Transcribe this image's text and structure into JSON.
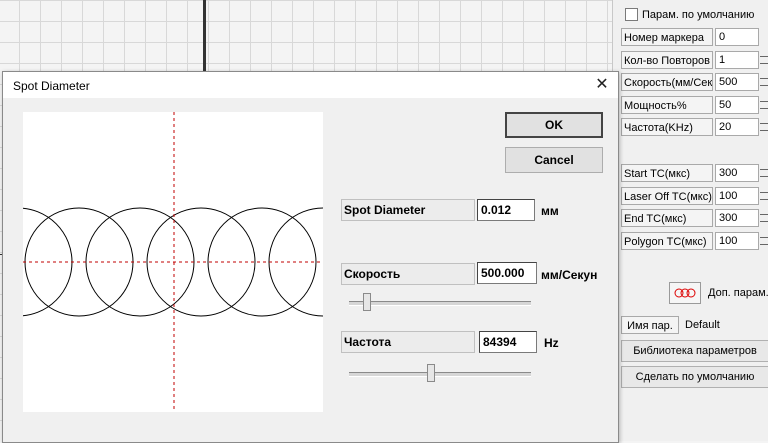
{
  "right_panel": {
    "default_checkbox": {
      "label": "Парам. по умолчанию",
      "checked": false
    },
    "params_top": [
      {
        "label": "Номер маркера",
        "value": "0",
        "spinner": false
      },
      {
        "label": "Кол-во Повторов",
        "value": "1",
        "spinner": true
      },
      {
        "label": "Скорость(мм/Сек",
        "value": "500",
        "spinner": true
      },
      {
        "label": "Мощность%",
        "value": "50",
        "spinner": true
      },
      {
        "label": "Частота(KHz)",
        "value": "20",
        "spinner": true
      }
    ],
    "params_timing": [
      {
        "label": "Start TC(мкс)",
        "value": "300",
        "spinner": true
      },
      {
        "label": "Laser Off TC(мкс)",
        "value": "100",
        "spinner": true
      },
      {
        "label": "End TC(мкс)",
        "value": "300",
        "spinner": true
      },
      {
        "label": "Polygon TC(мкс)",
        "value": "100",
        "spinner": true
      }
    ],
    "extra_params_label": "Доп. парам.",
    "name_label": "Имя пар.",
    "name_value": "Default",
    "library_button": "Библиотека параметров",
    "make_default_button": "Сделать по умолчанию"
  },
  "dialog": {
    "title": "Spot Diameter",
    "close_glyph": "✕",
    "ok_label": "OK",
    "cancel_label": "Cancel",
    "spot_diameter": {
      "label": "Spot Diameter",
      "value": "0.012",
      "unit": "мм"
    },
    "speed": {
      "label": "Скорость",
      "value": "500.000",
      "unit": "мм/Секун",
      "slider_fraction": 0.08
    },
    "frequency": {
      "label": "Частота",
      "value": "84394",
      "unit": "Hz",
      "slider_fraction": 0.45
    },
    "preview": {
      "circle_count": 6,
      "crosshair_color": "#c00000"
    }
  }
}
